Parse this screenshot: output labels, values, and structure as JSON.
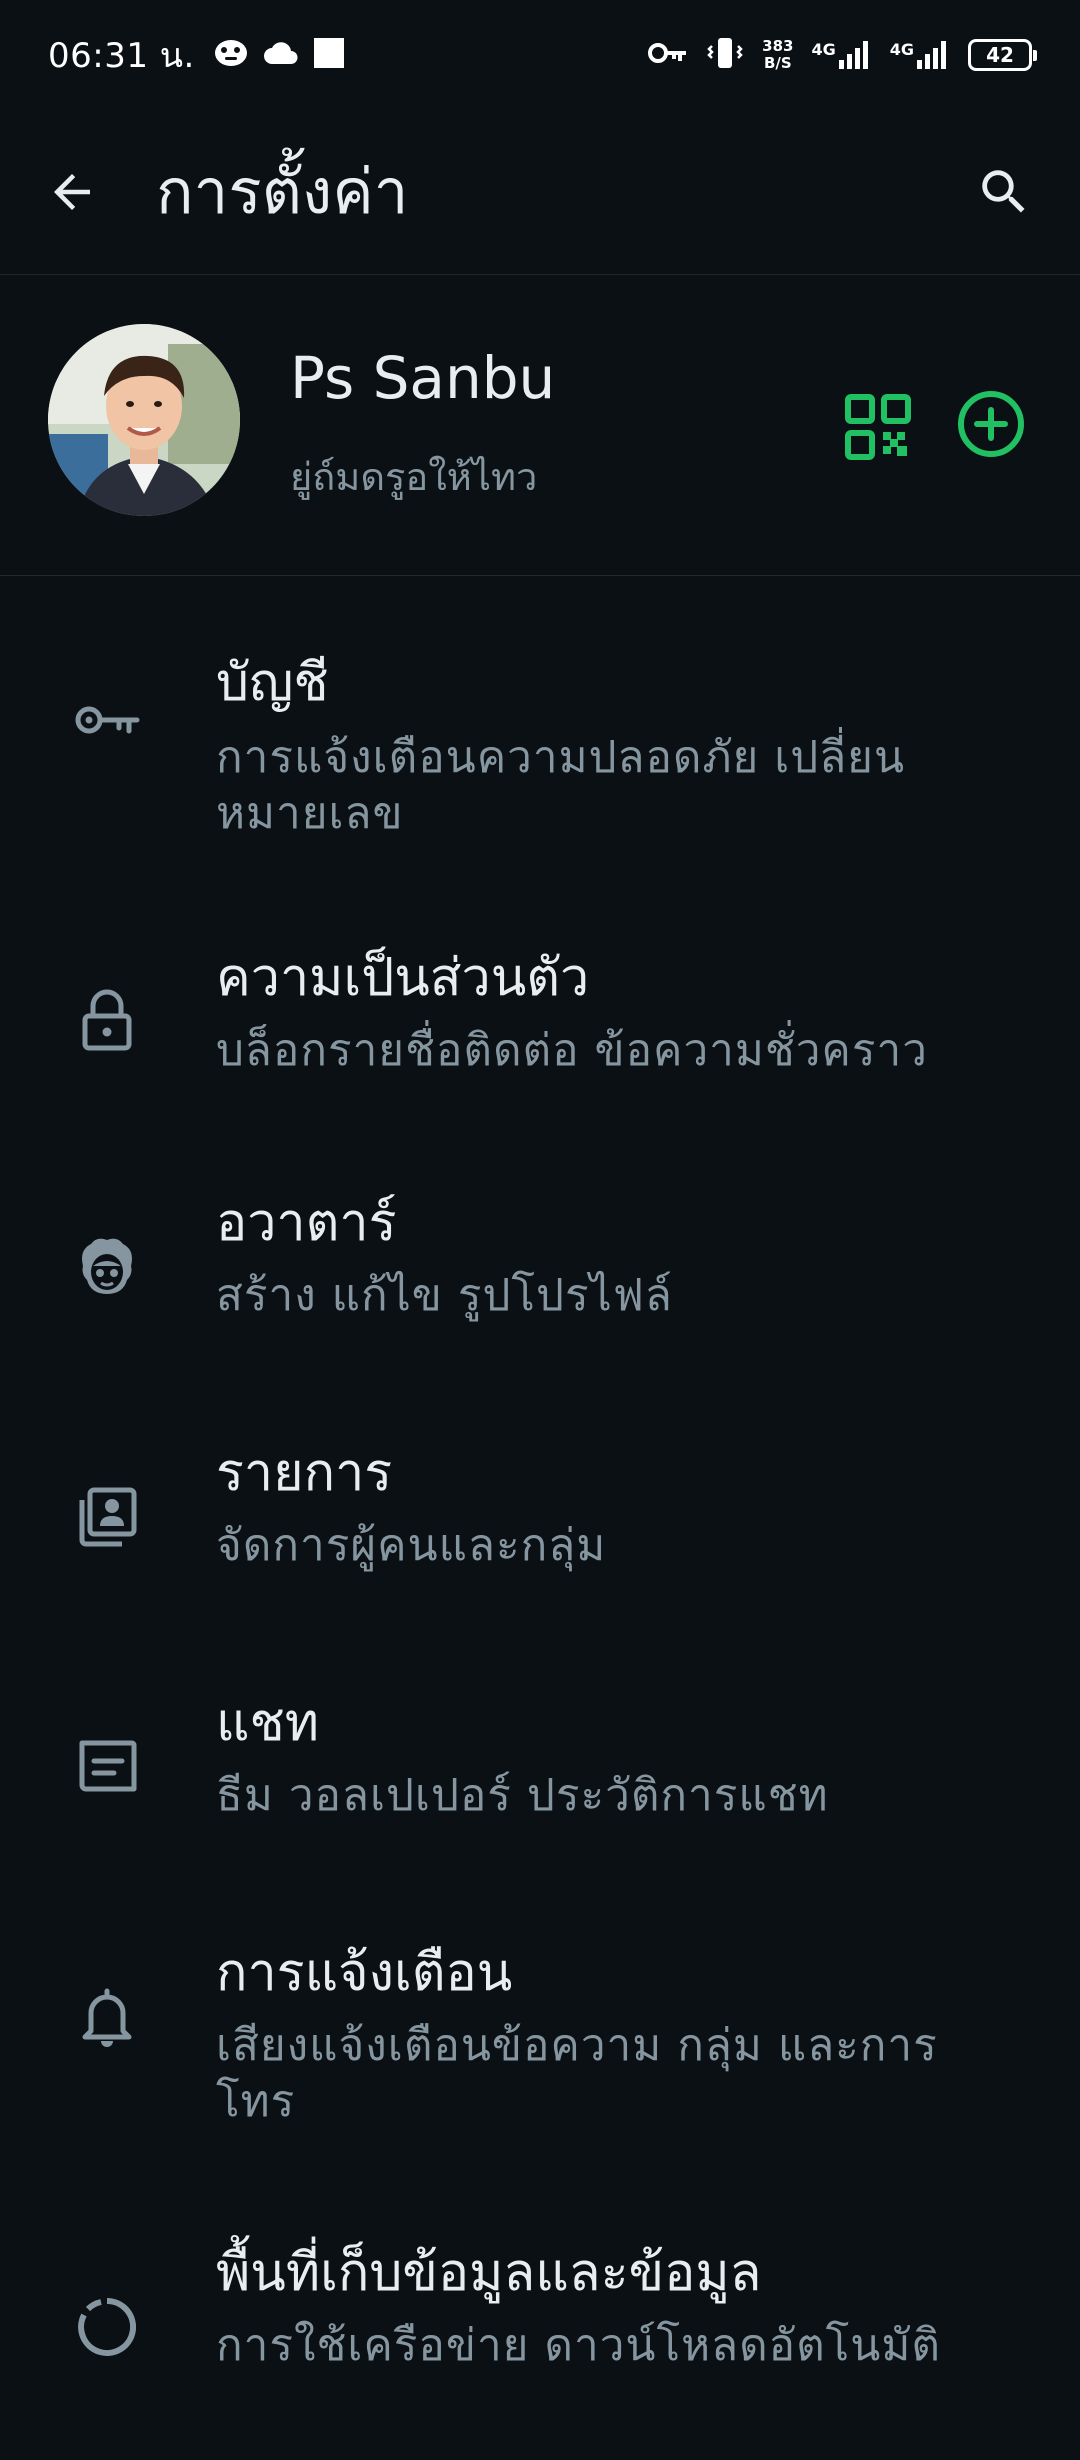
{
  "status_bar": {
    "time": "06:31 น.",
    "speed_value": "383",
    "speed_unit": "B/S",
    "net1": "4G",
    "net2": "4G",
    "battery": "42"
  },
  "app_bar": {
    "title": "การตั้งค่า"
  },
  "profile": {
    "name": "Ps Sanbu",
    "status": "ยู่ถ์มดรูอให้ไทว"
  },
  "settings": [
    {
      "title": "บัญชี",
      "subtitle": "การแจ้งเตือนความปลอดภัย เปลี่ยนหมายเลข",
      "icon": "key-icon"
    },
    {
      "title": "ความเป็นส่วนตัว",
      "subtitle": "บล็อกรายชื่อติดต่อ ข้อความชั่วคราว",
      "icon": "lock-icon"
    },
    {
      "title": "อวาตาร์",
      "subtitle": "สร้าง แก้ไข รูปโปรไฟล์",
      "icon": "avatar-face-icon"
    },
    {
      "title": "รายการ",
      "subtitle": "จัดการผู้คนและกลุ่ม",
      "icon": "contacts-list-icon"
    },
    {
      "title": "แชท",
      "subtitle": "ธีม วอลเปเปอร์ ประวัติการแชท",
      "icon": "chat-icon"
    },
    {
      "title": "การแจ้งเตือน",
      "subtitle": "เสียงแจ้งเตือนข้อความ กลุ่ม และการโทร",
      "icon": "bell-icon"
    },
    {
      "title": "พื้นที่เก็บข้อมูลและข้อมูล",
      "subtitle": "การใช้เครือข่าย ดาวน์โหลดอัตโนมัติ",
      "icon": "storage-circle-icon"
    }
  ],
  "colors": {
    "background": "#0b1014",
    "accent": "#21c063",
    "primary_text": "#e9edef",
    "secondary_text": "#8696a0"
  }
}
